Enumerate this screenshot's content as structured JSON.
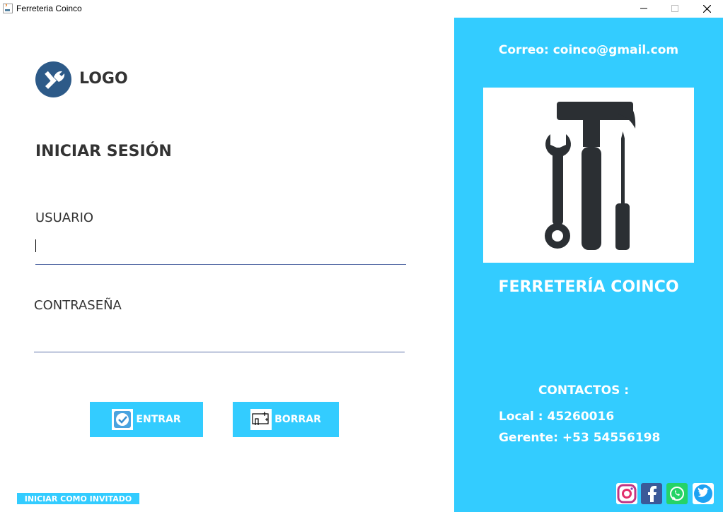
{
  "window": {
    "title": "Ferreteria Coinco",
    "controls": {
      "minimize": "minimize-icon",
      "maximize": "maximize-icon",
      "close": "close-icon"
    }
  },
  "login": {
    "logo_text": "LOGO",
    "heading": "INICIAR SESIÓN",
    "user_label": "USUARIO",
    "user_value": "",
    "password_label": "CONTRASEÑA",
    "password_value": "",
    "enter_label": "ENTRAR",
    "clear_label": "BORRAR",
    "guest_label": "INICIAR COMO INVITADO"
  },
  "side": {
    "email": "Correo: coinco@gmail.com",
    "brand": "FERRETERÍA COINCO",
    "contacts_title": "CONTACTOS :",
    "local": "Local : 45260016",
    "manager": "Gerente: +53 54556198",
    "social": [
      "instagram-icon",
      "facebook-icon",
      "whatsapp-icon",
      "twitter-icon"
    ]
  },
  "colors": {
    "accent": "#33ccff",
    "logo": "#2d5a88",
    "field_line": "#5a6fa8",
    "text": "#333333"
  }
}
